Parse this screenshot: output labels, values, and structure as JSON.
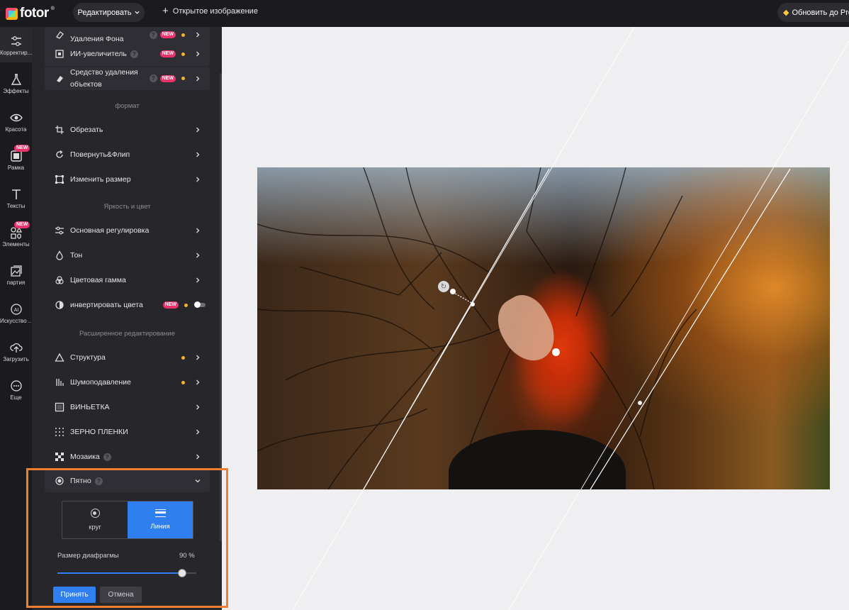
{
  "app": {
    "logo_text": "fotor",
    "logo_reg": "®",
    "edit_menu_label": "Редактировать",
    "open_image_label": "Открытое изображение",
    "upgrade_label": "Обновить до Pro"
  },
  "rail": {
    "items": [
      {
        "label": "Корректир...",
        "icon": "sliders-icon",
        "new": false,
        "active": true
      },
      {
        "label": "Эффекты",
        "icon": "flask-icon",
        "new": false
      },
      {
        "label": "Красота",
        "icon": "eye-icon",
        "new": false
      },
      {
        "label": "Рамка",
        "icon": "frame-icon",
        "new": true
      },
      {
        "label": "Тексты",
        "icon": "text-icon",
        "new": false
      },
      {
        "label": "Элементы",
        "icon": "shapes-icon",
        "new": true
      },
      {
        "label": "партия",
        "icon": "batch-icon",
        "new": false
      },
      {
        "label": "Искусство ...",
        "icon": "ai-icon",
        "new": false
      },
      {
        "label": "Загрузить",
        "icon": "upload-icon",
        "new": false
      },
      {
        "label": "Еще",
        "icon": "more-icon",
        "new": false
      }
    ],
    "new_badge": "NEW"
  },
  "panel": {
    "top_items": [
      {
        "label": "Удаления Фона",
        "icon": "eraser-icon",
        "help": true,
        "new": true,
        "dot": true
      },
      {
        "label": "ИИ-увеличитель",
        "icon": "enlarge-icon",
        "help": true,
        "new": true,
        "dot": true
      },
      {
        "label": "Средство удаления объектов",
        "icon": "eraser-icon",
        "help": true,
        "new": true,
        "dot": true
      }
    ],
    "sections": {
      "format": "формат",
      "brightness": "Яркость и цвет",
      "advanced": "Расширенное редактирование"
    },
    "format_items": [
      {
        "label": "Обрезать",
        "icon": "crop-icon"
      },
      {
        "label": "Повернуть&Флип",
        "icon": "rotate-icon"
      },
      {
        "label": "Изменить размер",
        "icon": "resize-icon"
      }
    ],
    "color_items": [
      {
        "label": "Основная регулировка",
        "icon": "sliders-icon"
      },
      {
        "label": "Тон",
        "icon": "drop-icon"
      },
      {
        "label": "Цветовая гамма",
        "icon": "palette-icon"
      },
      {
        "label": "инвертировать цвета",
        "icon": "invert-icon",
        "new": true,
        "dot": true,
        "toggle": true
      }
    ],
    "advanced_items": [
      {
        "label": "Структура",
        "icon": "triangle-icon",
        "dot": true
      },
      {
        "label": "Шумоподавление",
        "icon": "noise-icon",
        "dot": true
      },
      {
        "label": "ВИНЬЕТКА",
        "icon": "vignette-icon"
      },
      {
        "label": "ЗЕРНО ПЛЕНКИ",
        "icon": "grain-icon"
      },
      {
        "label": "Мозаика",
        "icon": "mosaic-icon",
        "help": true
      }
    ],
    "spot": {
      "label": "Пятно",
      "icon": "spot-icon",
      "help": true,
      "options": [
        {
          "label": "круг",
          "icon": "circle-option-icon",
          "selected": false
        },
        {
          "label": "Линия",
          "icon": "line-option-icon",
          "selected": true
        }
      ],
      "slider_label": "Размер диафрагмы",
      "slider_value_text": "90 %",
      "slider_value": 0.9,
      "apply_label": "Принять",
      "cancel_label": "Отмена"
    },
    "help_glyph": "?",
    "new_badge": "NEW"
  },
  "colors": {
    "accent": "#2f7ff0",
    "new_badge": "#e8346a",
    "pro_dot": "#f5b335",
    "highlight": "#f07e32"
  }
}
